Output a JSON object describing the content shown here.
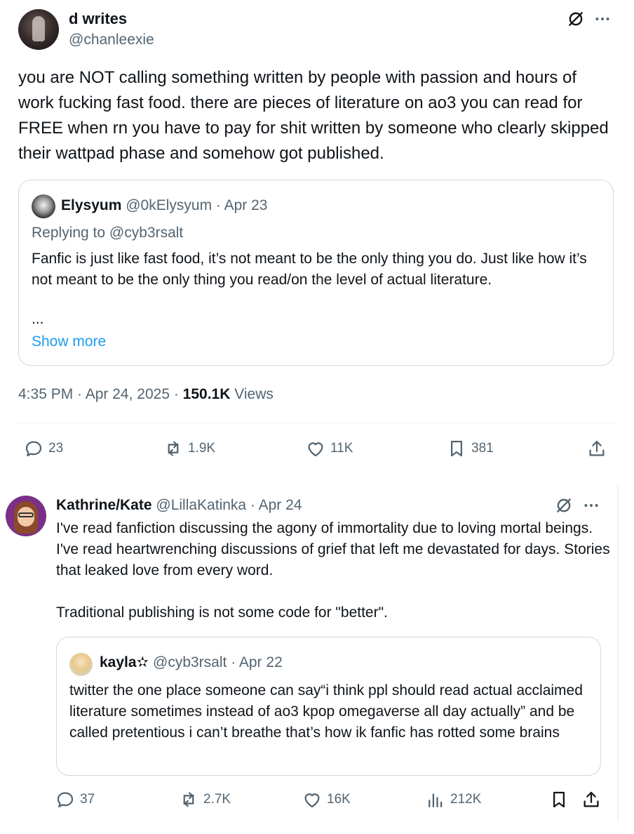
{
  "post1": {
    "author_name": "d writes",
    "author_handle": "@chanleexie",
    "text": "you are NOT calling something written by people with passion and hours of work fucking fast food. there are pieces of literature on ao3 you can read for FREE when rn you have to pay for shit written by someone who clearly skipped their wattpad phase and somehow got published.",
    "quote": {
      "author_name": "Elysyum",
      "author_handle": "@0kElysyum",
      "separator": " · ",
      "date": "Apr 23",
      "replying_to": "Replying to @cyb3rsalt",
      "text": "Fanfic is just like fast food, it’s not meant to be the only thing you do. Just like how it’s not meant to be the only thing you read/on the level of actual literature.",
      "ellipsis": "...",
      "show_more": "Show more"
    },
    "meta": {
      "time": "4:35 PM",
      "separator": " · ",
      "date": "Apr 24, 2025",
      "views_count": "150.1K",
      "views_label": " Views"
    },
    "actions": {
      "replies": "23",
      "reposts": "1.9K",
      "likes": "11K",
      "bookmarks": "381"
    },
    "icons": [
      "grok-icon",
      "more-icon",
      "reply-icon",
      "repost-icon",
      "like-icon",
      "bookmark-icon",
      "share-icon"
    ]
  },
  "post2": {
    "author_name": "Kathrine/Kate",
    "author_handle": "@LillaKatinka",
    "separator": " · ",
    "date": "Apr 24",
    "text_p1": "I've read fanfiction discussing the agony of immortality due to loving mortal beings. I've read heartwrenching discussions of grief that left me devastated for days. Stories that leaked love from every word.",
    "text_p2": "Traditional publishing is not some code for \"better\".",
    "quote": {
      "author_name": "kayla✫",
      "author_handle": "@cyb3rsalt",
      "separator": " · ",
      "date": "Apr 22",
      "text": "twitter the one place someone can say“i think ppl should read actual acclaimed literature sometimes instead of ao3 kpop omegaverse all day actually” and be called pretentious i can’t breathe that’s how ik fanfic has rotted some brains"
    },
    "actions": {
      "replies": "37",
      "reposts": "2.7K",
      "likes": "16K",
      "views": "212K"
    }
  },
  "colors": {
    "text": "#0f1419",
    "muted": "#536471",
    "link": "#1d9bf0",
    "border": "#cfd9de"
  }
}
